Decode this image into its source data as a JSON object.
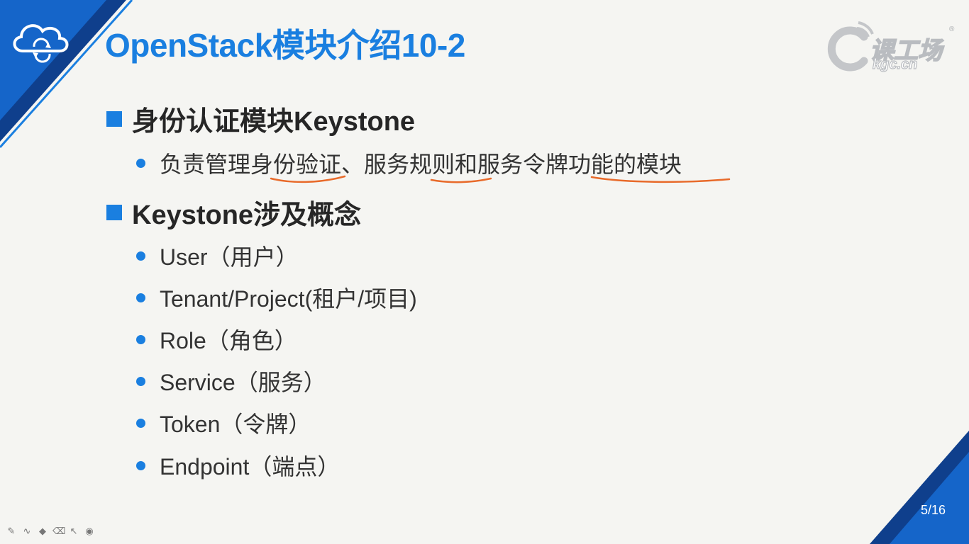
{
  "slide": {
    "title": "OpenStack模块介绍10-2",
    "sections": [
      {
        "heading": "身份认证模块Keystone",
        "items": [
          "负责管理身份验证、服务规则和服务令牌功能的模块"
        ]
      },
      {
        "heading": "Keystone涉及概念",
        "items": [
          "User（用户）",
          "Tenant/Project(租户/项目)",
          "Role（角色）",
          "Service（服务）",
          "Token（令牌）",
          "Endpoint（端点）"
        ]
      }
    ],
    "page_number": "5/16"
  },
  "logo": {
    "text": "课工场",
    "sub": "kgc.cn",
    "reg": "®"
  },
  "toolbar": {
    "tools": [
      {
        "icon": "pen-icon",
        "glyph": "✎"
      },
      {
        "icon": "curve-icon",
        "glyph": "∿"
      },
      {
        "icon": "highlighter-icon",
        "glyph": "◆"
      },
      {
        "icon": "eraser-icon",
        "glyph": "⌫"
      },
      {
        "icon": "pointer-icon",
        "glyph": "↖"
      },
      {
        "icon": "record-icon",
        "glyph": "◉"
      }
    ]
  },
  "colors": {
    "accent": "#1a7fe0",
    "dark_blue": "#0f3f8c",
    "annotation": "#e86a2a"
  }
}
